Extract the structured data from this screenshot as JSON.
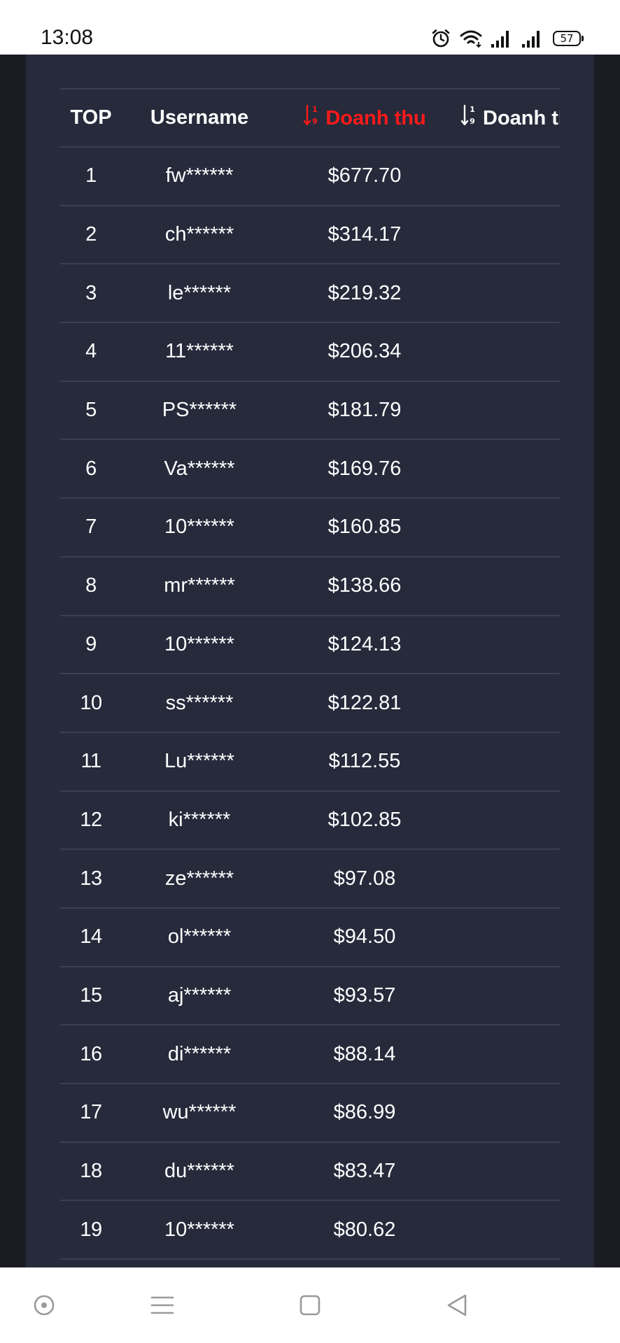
{
  "status_bar": {
    "time": "13:08",
    "battery": "57"
  },
  "table": {
    "headers": {
      "top": "TOP",
      "username": "Username",
      "revenue": "Doanh thu",
      "revenue_2": "Doanh thu"
    },
    "rows": [
      {
        "rank": "1",
        "username": "fw******",
        "revenue": "$677.70"
      },
      {
        "rank": "2",
        "username": "ch******",
        "revenue": "$314.17"
      },
      {
        "rank": "3",
        "username": "le******",
        "revenue": "$219.32"
      },
      {
        "rank": "4",
        "username": "11******",
        "revenue": "$206.34"
      },
      {
        "rank": "5",
        "username": "PS******",
        "revenue": "$181.79"
      },
      {
        "rank": "6",
        "username": "Va******",
        "revenue": "$169.76"
      },
      {
        "rank": "7",
        "username": "10******",
        "revenue": "$160.85"
      },
      {
        "rank": "8",
        "username": "mr******",
        "revenue": "$138.66"
      },
      {
        "rank": "9",
        "username": "10******",
        "revenue": "$124.13"
      },
      {
        "rank": "10",
        "username": "ss******",
        "revenue": "$122.81"
      },
      {
        "rank": "11",
        "username": "Lu******",
        "revenue": "$112.55"
      },
      {
        "rank": "12",
        "username": "ki******",
        "revenue": "$102.85"
      },
      {
        "rank": "13",
        "username": "ze******",
        "revenue": "$97.08"
      },
      {
        "rank": "14",
        "username": "ol******",
        "revenue": "$94.50"
      },
      {
        "rank": "15",
        "username": "aj******",
        "revenue": "$93.57"
      },
      {
        "rank": "16",
        "username": "di******",
        "revenue": "$88.14"
      },
      {
        "rank": "17",
        "username": "wu******",
        "revenue": "$86.99"
      },
      {
        "rank": "18",
        "username": "du******",
        "revenue": "$83.47"
      },
      {
        "rank": "19",
        "username": "10******",
        "revenue": "$80.62"
      }
    ]
  },
  "colors": {
    "panel_bg": "#262a3b",
    "side_bg": "#1b1b24",
    "active_sort": "#ff1a1a",
    "row_divider": "#3a3f52",
    "text": "#ffffff"
  },
  "icons": {
    "status": [
      "alarm-icon",
      "wifi-icon",
      "signal-icon",
      "signal-icon",
      "battery-icon"
    ],
    "sort": "sort-numeric-ascending-icon",
    "nav": [
      "circle-dot-icon",
      "menu-icon",
      "square-icon",
      "back-triangle-icon"
    ]
  }
}
